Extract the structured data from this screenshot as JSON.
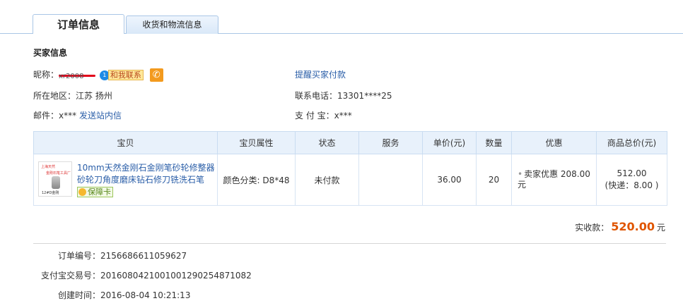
{
  "tabs": [
    {
      "label": "订单信息",
      "active": true
    },
    {
      "label": "收货和物流信息",
      "active": false
    }
  ],
  "buyer": {
    "section_title": "买家信息",
    "nick_label": "昵称：",
    "nick_value": "xr2008",
    "contact_badge": "1",
    "contact_label": "和我联系",
    "phone_icon": "phone-icon",
    "remind_link": "提醒买家付款",
    "region_label": "所在地区：",
    "region_value": "江苏 扬州",
    "phone_label": "联系电话：",
    "phone_value": "13301****25",
    "email_label": "邮件：",
    "email_value": "x***",
    "send_msg_link": "发送站内信",
    "alipay_label": "支 付 宝：",
    "alipay_value": "x***"
  },
  "table": {
    "headers": [
      "宝贝",
      "宝贝属性",
      "状态",
      "服务",
      "单价(元)",
      "数量",
      "优惠",
      "商品总价(元)"
    ],
    "row": {
      "thumb_text1": "上海天然",
      "thumb_text2": "金刚石笔工具厂",
      "thumb_text3": "12#D金刚",
      "title": "10mm天然金刚石金刚笔砂轮修整器砂轮刀角度磨床钻石修刀铣洗石笔",
      "guarantee": "保障卡",
      "attr": "颜色分类: D8*48",
      "status": "未付款",
      "service": "",
      "price": "36.00",
      "qty": "20",
      "discount_bullet": "•",
      "discount": "卖家优惠 208.00 元",
      "total": "512.00",
      "shipping": "(快递：8.00 )"
    }
  },
  "payment": {
    "label": "实收款：",
    "amount": "520.00",
    "unit": "元"
  },
  "order_meta": {
    "order_no_label": "订单编号：",
    "order_no": "2156686611059627",
    "alipay_trade_label": "支付宝交易号：",
    "alipay_trade": "2016080421001001290254871082",
    "created_label": "创建时间：",
    "created": "2016-08-04 10:21:13"
  }
}
